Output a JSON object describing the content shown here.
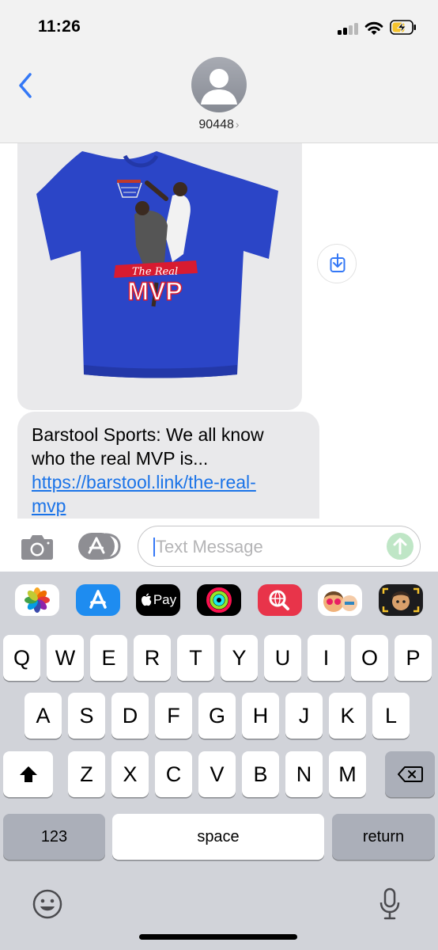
{
  "status_bar": {
    "time": "11:26"
  },
  "header": {
    "contact_name": "90448",
    "chevron": "›"
  },
  "messages": {
    "image_alt": "Blue t-shirt with basketball graphic",
    "shirt_graphic_line1": "The Real",
    "shirt_graphic_line2": "MVP",
    "text_body_line1": "Barstool Sports: We all know",
    "text_body_line2": "who the real MVP is...",
    "link_line1": "https://barstool.link/the-real-",
    "link_line2": "mvp"
  },
  "compose": {
    "placeholder": "Text Message"
  },
  "keyboard": {
    "apps": {
      "photos": "photos-icon",
      "app_store": "app-store-icon",
      "apple_pay": "Pay",
      "activity": "activity-icon",
      "search": "web-search-icon",
      "memoji_1": "memoji-icon",
      "memoji_2": "memoji-stickers-icon"
    },
    "row1": [
      "Q",
      "W",
      "E",
      "R",
      "T",
      "Y",
      "U",
      "I",
      "O",
      "P"
    ],
    "row2": [
      "A",
      "S",
      "D",
      "F",
      "G",
      "H",
      "J",
      "K",
      "L"
    ],
    "row3": [
      "Z",
      "X",
      "C",
      "V",
      "B",
      "N",
      "M"
    ],
    "numbers_label": "123",
    "space_label": "space",
    "return_label": "return"
  },
  "colors": {
    "ios_blue": "#3478f6",
    "link": "#1a73e8",
    "bubble_gray": "#e9e9eb",
    "shirt_blue": "#2b45c7"
  }
}
